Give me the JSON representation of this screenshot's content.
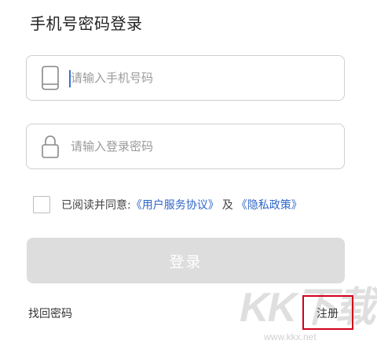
{
  "header": {
    "title": "手机号密码登录"
  },
  "phone_field": {
    "placeholder": "请输入手机号码",
    "value": "",
    "icon": "phone-icon"
  },
  "password_field": {
    "placeholder": "请输入登录密码",
    "value": "",
    "icon": "lock-icon"
  },
  "agreement": {
    "checked": false,
    "prefix": "已阅读并同意:",
    "user_agreement_link": "《用户服务协议》",
    "and_text": "及",
    "privacy_link": "《隐私政策》"
  },
  "login_button": {
    "label": "登录",
    "enabled": false
  },
  "footer": {
    "forgot_password": "找回密码",
    "register": "注册"
  },
  "watermark": {
    "logo_text": "KK下载",
    "url": "www.kkx.net"
  },
  "colors": {
    "link": "#2f66c8",
    "button_disabled_bg": "#dddddd",
    "highlight_box": "#d0021b",
    "caret": "#3a6fd8"
  }
}
